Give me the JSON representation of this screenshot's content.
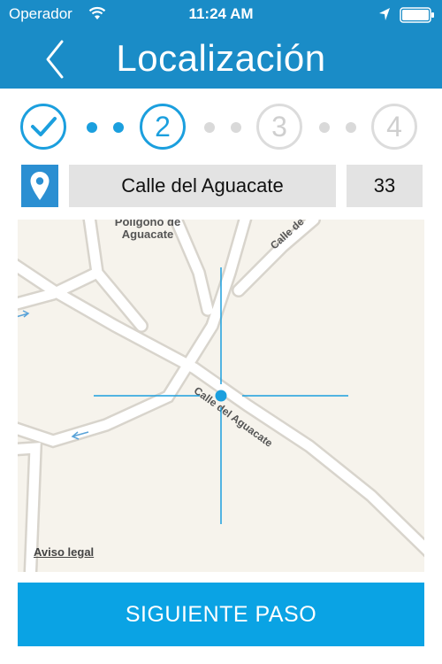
{
  "status": {
    "carrier": "Operador",
    "time": "11:24 AM"
  },
  "nav": {
    "title": "Localización"
  },
  "steps": [
    {
      "number": "",
      "state": "done"
    },
    {
      "number": "2",
      "state": "current"
    },
    {
      "number": "3",
      "state": "pending"
    },
    {
      "number": "4",
      "state": "pending"
    }
  ],
  "address": {
    "street": "Calle del Aguacate",
    "number": "33"
  },
  "map": {
    "area_label": "Polígono de Aguacate",
    "street_label_top": "Calle de",
    "street_label_center": "Calle del Aguacate",
    "legal_link": "Aviso legal"
  },
  "next_button": {
    "label": "SIGUIENTE PASO"
  },
  "colors": {
    "brand": "#1a8cc7",
    "accent": "#1b9fde",
    "button": "#0aa3e4",
    "inactive": "#d9d9d9"
  }
}
